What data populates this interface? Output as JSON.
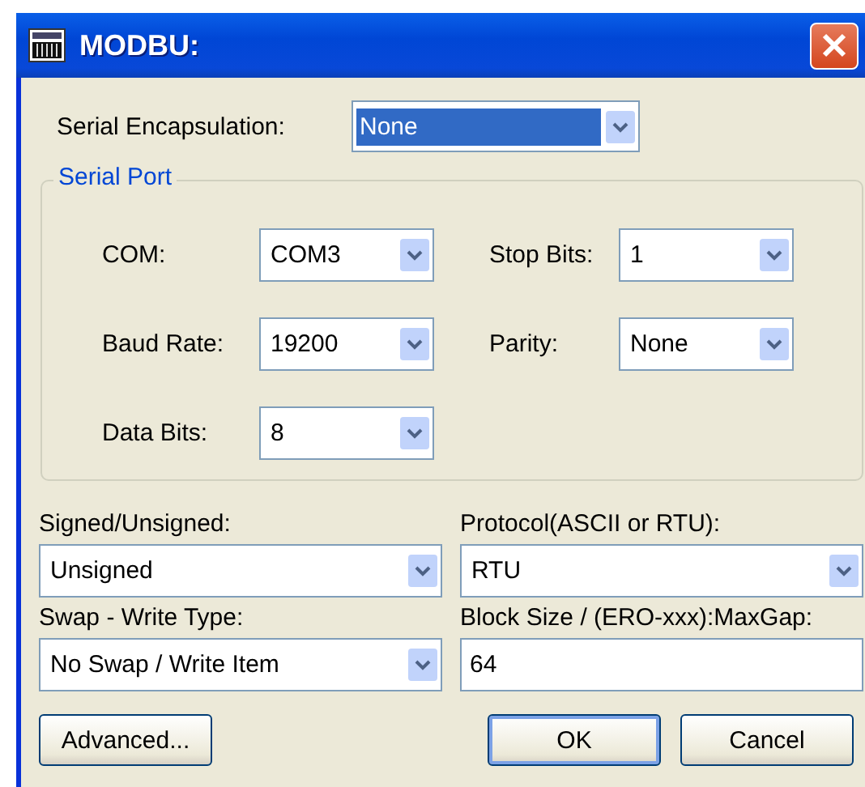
{
  "window": {
    "title": "MODBU:"
  },
  "serial_encapsulation": {
    "label": "Serial Encapsulation:",
    "value": "None",
    "focused": true
  },
  "serial_port": {
    "title": "Serial Port",
    "fields": [
      {
        "label": "COM:",
        "value": "COM3"
      },
      {
        "label": "Stop Bits:",
        "value": "1"
      },
      {
        "label": "Baud Rate:",
        "value": "19200"
      },
      {
        "label": "Parity:",
        "value": "None"
      },
      {
        "label": "Data Bits:",
        "value": "8"
      }
    ]
  },
  "settings": [
    {
      "kind": "combo",
      "label": "Signed/Unsigned:",
      "value": "Unsigned"
    },
    {
      "kind": "combo",
      "label": "Protocol(ASCII or RTU):",
      "value": "RTU"
    },
    {
      "kind": "combo",
      "label": "Swap - Write Type:",
      "value": "No Swap / Write Item"
    },
    {
      "kind": "text",
      "label": "Block Size / (ERO-xxx):MaxGap:",
      "value": "64"
    }
  ],
  "buttons": [
    {
      "label": "Advanced...",
      "default": false
    },
    {
      "label": "OK",
      "default": true
    },
    {
      "label": "Cancel",
      "default": false
    }
  ]
}
